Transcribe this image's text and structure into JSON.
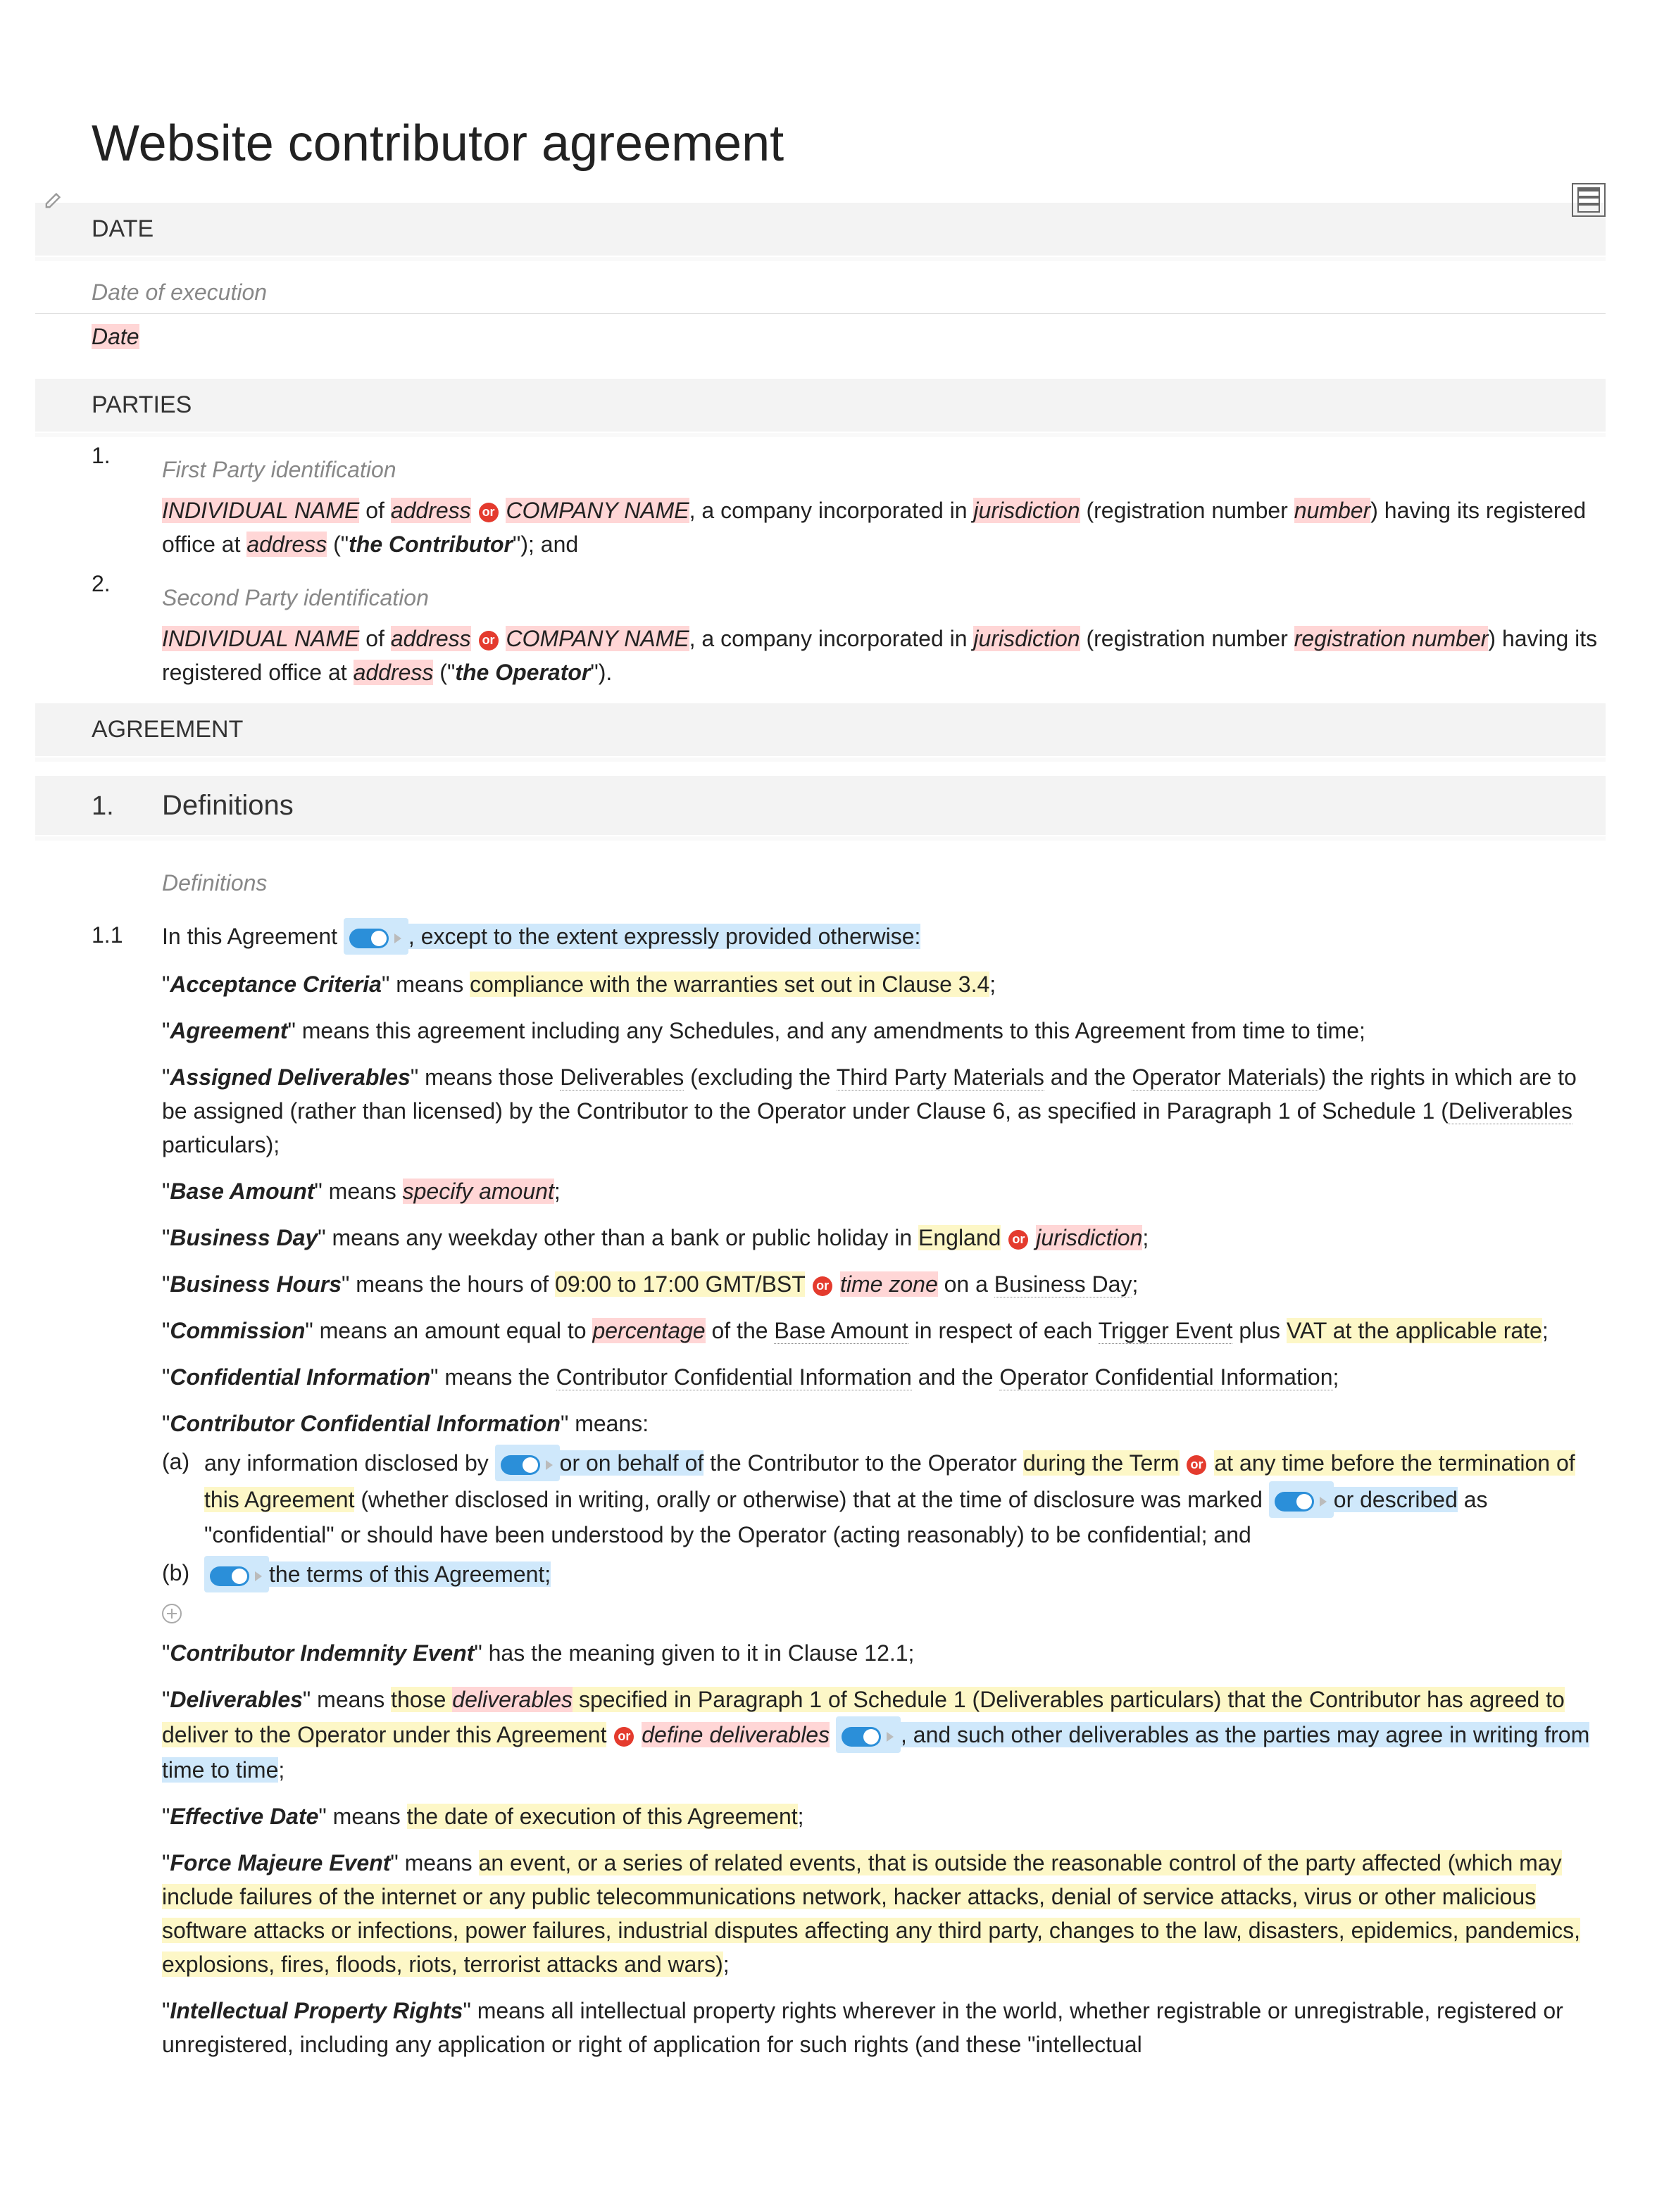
{
  "title": "Website contributor agreement",
  "sections": {
    "date": {
      "header": "DATE",
      "label": "Date of execution",
      "value": "Date"
    },
    "parties": {
      "header": "PARTIES",
      "first_label": "First Party identification",
      "second_label": "Second Party identification",
      "p1": {
        "num": "1.",
        "indiv": "INDIVIDUAL NAME",
        "of": " of ",
        "addr1": "address",
        "or": "or",
        "comp": "COMPANY NAME",
        "txt1": ", a company incorporated in ",
        "juris": "jurisdiction",
        "txt2": " (registration number ",
        "regnum": "number",
        "txt3": ") having its registered office at ",
        "addr2": "address",
        "txt4": " (\"",
        "bold": "the Contributor",
        "txt5": "\"); and"
      },
      "p2": {
        "num": "2.",
        "indiv": "INDIVIDUAL NAME",
        "of": " of ",
        "addr1": "address",
        "or": "or",
        "comp": "COMPANY NAME",
        "txt1": ", a company incorporated in ",
        "juris": "jurisdiction",
        "txt2": " (registration number ",
        "regnum": "registration number",
        "txt3": ") having its registered office at ",
        "addr2": "address",
        "txt4": " (\"",
        "bold": "the Operator",
        "txt5": "\")."
      }
    },
    "agreement": {
      "header": "AGREEMENT",
      "defs": {
        "num": "1.",
        "title": "Definitions",
        "label": "Definitions",
        "row": {
          "num": "1.1",
          "intro_a": "In this Agreement ",
          "intro_b": ", except to the extent expressly provided otherwise:"
        },
        "d_accept": {
          "term": "Acceptance Criteria",
          "t1": "\" means ",
          "hl": "compliance with the warranties set out in Clause 3.4",
          "t2": ";"
        },
        "d_agreement": {
          "term": "Agreement",
          "t1": "\" means this agreement including any Schedules, and any amendments to this Agreement from time to time;"
        },
        "d_assigned": {
          "term": "Assigned Deliverables",
          "t1": "\" means those ",
          "dl": "Deliverables",
          "t2": " (excluding the ",
          "tpm": "Third Party Materials",
          "t3": " and the ",
          "om": "Operator Materials",
          "t4": ") the rights in which are to be assigned (rather than licensed) by the Contributor to the Operator under Clause 6, as specified in Paragraph 1 of Schedule 1 (",
          "dl2": "Deliverables",
          "t5": " particulars);"
        },
        "d_base": {
          "term": "Base Amount",
          "t1": "\" means ",
          "hl": "specify amount",
          "t2": ";"
        },
        "d_bday": {
          "term": "Business Day",
          "t1": "\" means any weekday other than a bank or public holiday in ",
          "eng": "England",
          "or": "or",
          "juris": "jurisdiction",
          "t2": ";"
        },
        "d_bhours": {
          "term": "Business Hours",
          "t1": "\" means the hours of ",
          "hrs": "09:00 to 17:00 GMT/BST",
          "or": "or",
          "tz": "time zone",
          "t2": " on a ",
          "bd": "Business Day",
          "t3": ";"
        },
        "d_comm": {
          "term": "Commission",
          "t1": "\" means an amount equal to ",
          "pct": "percentage",
          "t2": " of the ",
          "ba": "Base Amount",
          "t3": " in respect of each ",
          "te": "Trigger Event",
          "t4": " plus ",
          "vat": "VAT at the applicable rate",
          "t5": ";"
        },
        "d_conf": {
          "term": "Confidential Information",
          "t1": "\" means the ",
          "cci": "Contributor Confidential Information",
          "t2": " and the ",
          "oci": "Operator Confidential Information",
          "t3": ";"
        },
        "d_cci": {
          "term": "Contributor Confidential Information",
          "t1": "\" means:",
          "a": {
            "mk": "(a)",
            "t1": "any information disclosed by ",
            "hl1": "or on behalf of",
            "t2": " the Contributor to the Operator ",
            "hl2": "during the Term",
            "or": "or",
            "hl3": "at any time before the termination of this Agreement",
            "t3": " (whether disclosed in writing, orally or otherwise) that at the time of disclosure was marked ",
            "hl4": "or described",
            "t4": " as \"confidential\" or should have been understood by the Operator (acting reasonably) to be confidential; and"
          },
          "b": {
            "mk": "(b)",
            "hl": "the terms of this Agreement;"
          }
        },
        "d_cie": {
          "term": "Contributor Indemnity Event",
          "t1": "\" has the meaning given to it in Clause 12.1;"
        },
        "d_deliv": {
          "term": "Deliverables",
          "t1": "\" means ",
          "hl1": "those ",
          "hl1b": "deliverables",
          "hl1c": " specified in Paragraph 1 of Schedule 1 (Deliverables particulars) that the Contributor has agreed to deliver to the Operator under this Agreement",
          "or": "or",
          "hl2": "define deliverables",
          "hl3": ", and such other deliverables as the parties may agree in writing from time to time",
          "t2": ";"
        },
        "d_eff": {
          "term": "Effective Date",
          "t1": "\" means ",
          "hl": "the date of execution of this Agreement",
          "t2": ";"
        },
        "d_fm": {
          "term": "Force Majeure Event",
          "t1": "\" means ",
          "hl": "an event, or a series of related events, that is outside the reasonable control of the party affected (which may include failures of the internet or any public telecommunications network, hacker attacks, denial of service attacks, virus or other malicious software attacks or infections, power failures, industrial disputes affecting any third party, changes to the law, disasters, epidemics, pandemics, explosions, fires, floods, riots, terrorist attacks and wars)",
          "t2": ";"
        },
        "d_ipr": {
          "term": "Intellectual Property Rights",
          "t1": "\" means all intellectual property rights wherever in the world, whether registrable or unregistrable, registered or unregistered, including any application or right of application for such rights (and these \"intellectual"
        }
      }
    }
  }
}
